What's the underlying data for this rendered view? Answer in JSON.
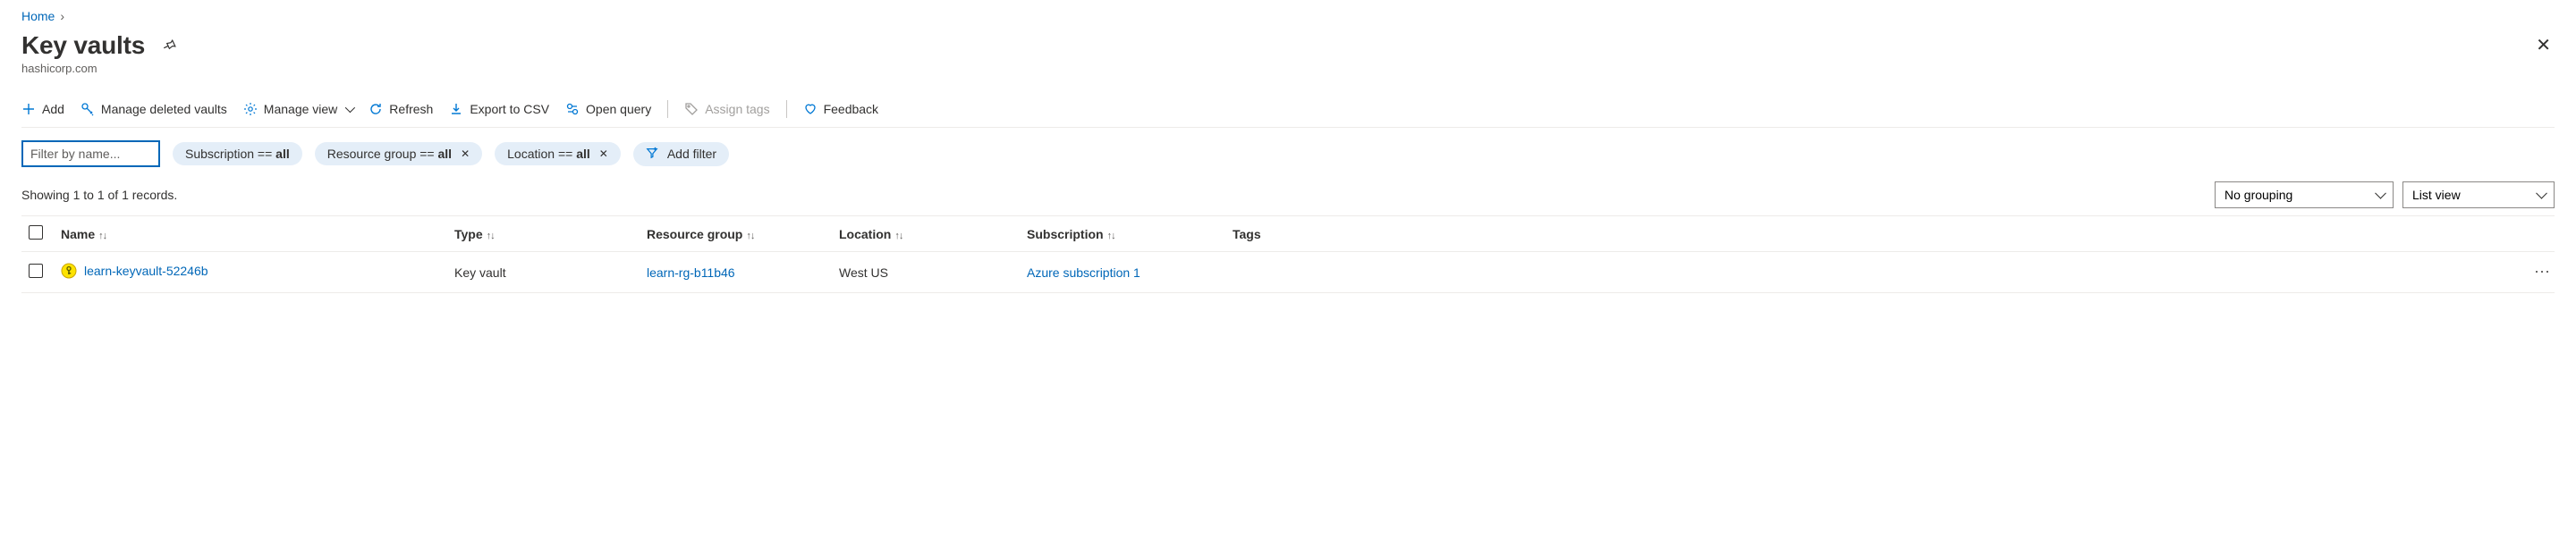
{
  "breadcrumb": {
    "home": "Home"
  },
  "header": {
    "title": "Key vaults",
    "subtitle": "hashicorp.com"
  },
  "toolbar": {
    "add": "Add",
    "manage_deleted": "Manage deleted vaults",
    "manage_view": "Manage view",
    "refresh": "Refresh",
    "export_csv": "Export to CSV",
    "open_query": "Open query",
    "assign_tags": "Assign tags",
    "feedback": "Feedback"
  },
  "filters": {
    "placeholder": "Filter by name...",
    "subscription": "Subscription == ",
    "subscription_val": "all",
    "rg": "Resource group == ",
    "rg_val": "all",
    "loc": "Location == ",
    "loc_val": "all",
    "add_filter": "Add filter"
  },
  "meta": {
    "records": "Showing 1 to 1 of 1 records.",
    "grouping": "No grouping",
    "view": "List view"
  },
  "columns": {
    "name": "Name",
    "type": "Type",
    "rg": "Resource group",
    "location": "Location",
    "subscription": "Subscription",
    "tags": "Tags"
  },
  "rows": [
    {
      "name": "learn-keyvault-52246b",
      "type": "Key vault",
      "rg": "learn-rg-b11b46",
      "location": "West US",
      "subscription": "Azure subscription 1",
      "tags": ""
    }
  ]
}
